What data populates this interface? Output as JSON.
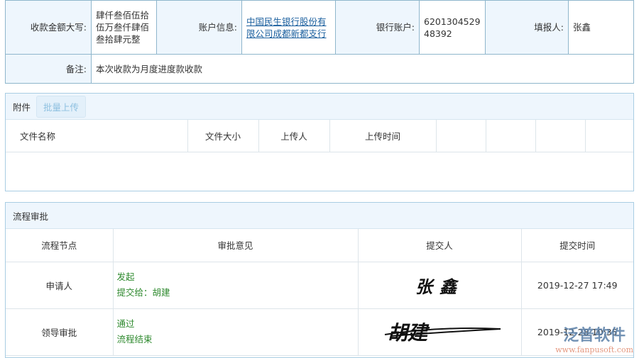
{
  "info": {
    "amount_label": "收款金额大写:",
    "amount_value": "肆仟叁佰伍拾伍万叁仟肆佰叁拾肆元整",
    "account_label": "账户信息:",
    "account_value": "中国民生银行股份有限公司成都新都支行",
    "bank_label": "银行账户:",
    "bank_value": "620130452948392",
    "reporter_label": "填报人:",
    "reporter_value": "张鑫",
    "remark_label": "备注:",
    "remark_value": "本次收款为月度进度款收款"
  },
  "attachments": {
    "title": "附件",
    "upload_button": "批量上传",
    "columns": [
      "文件名称",
      "文件大小",
      "上传人",
      "上传时间"
    ]
  },
  "workflow": {
    "title": "流程审批",
    "columns": [
      "流程节点",
      "审批意见",
      "提交人",
      "提交时间"
    ],
    "rows": [
      {
        "node": "申请人",
        "opinion": "发起",
        "next": "提交给：胡建",
        "submitter": "张鑫",
        "time": "2019-12-27 17:49"
      },
      {
        "node": "领导审批",
        "opinion": "通过",
        "next": "流程结束",
        "submitter": "胡建",
        "time": "2019-12-28 10:35"
      }
    ]
  },
  "watermark": {
    "name": "泛普软件",
    "url": "www.fanpusoft.com"
  }
}
